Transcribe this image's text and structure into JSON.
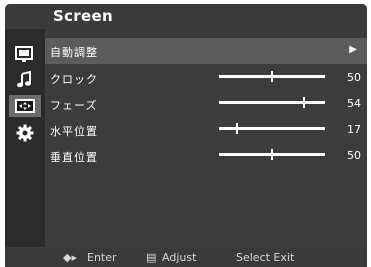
{
  "menu": {
    "title": "Screen"
  },
  "sidebar": {
    "items": [
      {
        "icon": "picture-icon",
        "active": false
      },
      {
        "icon": "music-note-icon",
        "active": false
      },
      {
        "icon": "screen-icon",
        "active": true
      },
      {
        "icon": "gear-icon",
        "active": false
      }
    ]
  },
  "rows": [
    {
      "label": "自動調整",
      "arrow": "▶"
    },
    {
      "label": "クロック",
      "value": "50",
      "level": 0.5
    },
    {
      "label": "フェーズ",
      "value": "54",
      "level": 0.8
    },
    {
      "label": "水平位置",
      "value": "17",
      "level": 0.17
    },
    {
      "label": "垂直位置",
      "value": "50",
      "level": 0.5
    }
  ],
  "footer": {
    "enter_icon": "◆▸",
    "enter_label": "Enter",
    "adjust_icon": "▤",
    "adjust_label": "Adjust",
    "select_exit_label": "Select Exit"
  },
  "colors": {
    "background": "#2b2b2b",
    "content": "#3c3c3c",
    "selected_row": "#5c5c5c",
    "active_icon": "#6c6c6c",
    "text": "#ffffff"
  }
}
